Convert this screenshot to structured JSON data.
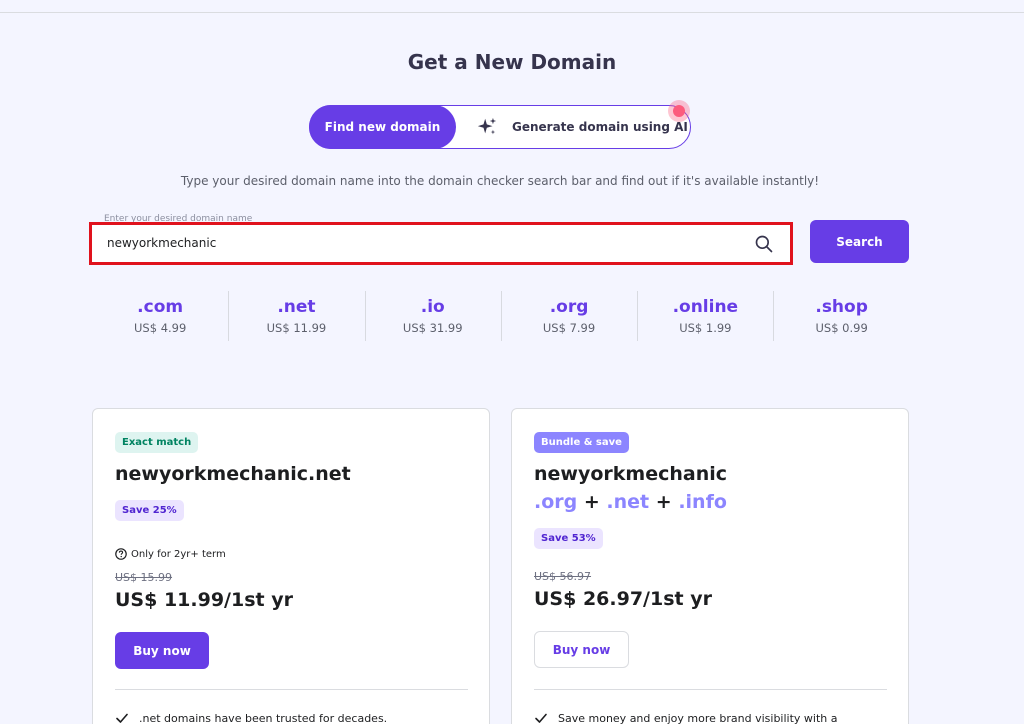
{
  "page": {
    "title": "Get a New Domain",
    "subtitle": "Type your desired domain name into the domain checker search bar and find out if it's available instantly!"
  },
  "toggle": {
    "find_label": "Find new domain",
    "ai_label": "Generate domain using AI"
  },
  "search": {
    "field_label": "Enter your desired domain name",
    "value": "newyorkmechanic",
    "button_label": "Search"
  },
  "tlds": [
    {
      "ext": ".com",
      "price": "US$ 4.99"
    },
    {
      "ext": ".net",
      "price": "US$ 11.99"
    },
    {
      "ext": ".io",
      "price": "US$ 31.99"
    },
    {
      "ext": ".org",
      "price": "US$ 7.99"
    },
    {
      "ext": ".online",
      "price": "US$ 1.99"
    },
    {
      "ext": ".shop",
      "price": "US$ 0.99"
    }
  ],
  "cards": [
    {
      "badge": "Exact match",
      "domain": "newyorkmechanic.net",
      "save": "Save 25%",
      "note": "Only for 2yr+ term",
      "old_price": "US$ 15.99",
      "price": "US$ 11.99/1st yr",
      "button": "Buy now",
      "feature": ".net domains have been trusted for decades."
    },
    {
      "badge": "Bundle & save",
      "domain": "newyorkmechanic",
      "exts": [
        ".org",
        "+",
        ".net",
        "+",
        ".info"
      ],
      "save": "Save 53%",
      "old_price": "US$ 56.97",
      "price": "US$ 26.97/1st yr",
      "button": "Buy now",
      "feature": "Save money and enjoy more brand visibility with a"
    }
  ],
  "colors": {
    "accent": "#673de6",
    "background": "#f4f5ff",
    "highlight_border": "#e0121d"
  }
}
